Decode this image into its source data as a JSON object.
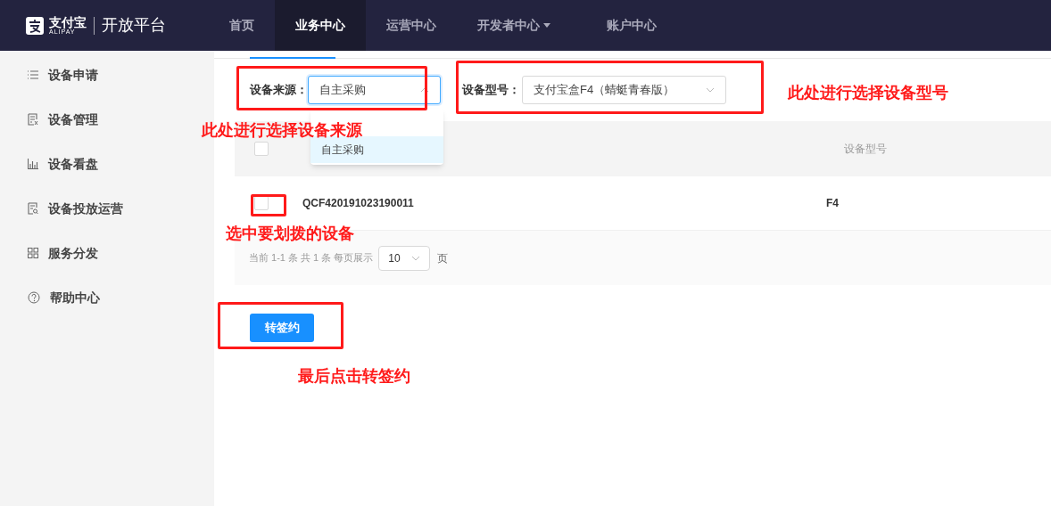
{
  "header": {
    "logo_cn": "支付宝",
    "logo_en": "ALIPAY",
    "platform": "开放平台",
    "nav": [
      {
        "label": "首页",
        "selected": false,
        "dropdown": false
      },
      {
        "label": "业务中心",
        "selected": true,
        "dropdown": false
      },
      {
        "label": "运营中心",
        "selected": false,
        "dropdown": false
      },
      {
        "label": "开发者中心",
        "selected": false,
        "dropdown": true
      },
      {
        "label": "账户中心",
        "selected": false,
        "dropdown": false
      }
    ]
  },
  "sidebar": {
    "items": [
      {
        "label": "设备申请"
      },
      {
        "label": "设备管理"
      },
      {
        "label": "设备看盘"
      },
      {
        "label": "设备投放运营"
      },
      {
        "label": "服务分发"
      },
      {
        "label": "帮助中心"
      }
    ]
  },
  "filters": [
    {
      "label": "设备来源：",
      "value": "自主采购",
      "expanded": true
    },
    {
      "label": "设备型号：",
      "value": "支付宝盒F4（蜻蜓青春版）",
      "expanded": false
    }
  ],
  "dropdown_options": [
    {
      "label": "自主采购",
      "selected": true
    }
  ],
  "table": {
    "select_all_checked": false,
    "columns": [
      "设备型号"
    ],
    "rows": [
      {
        "checked": false,
        "serial": "QCF420191023190011",
        "model": "F4"
      }
    ]
  },
  "pagination": {
    "summary": "当前 1-1 条 共 1 条 每页展示",
    "page_size": "10",
    "unit": "页"
  },
  "action_button": "转签约",
  "annotations": [
    "此处进行选择设备来源",
    "此处进行选择设备型号",
    "选中要划拨的设备",
    "最后点击转签约"
  ]
}
